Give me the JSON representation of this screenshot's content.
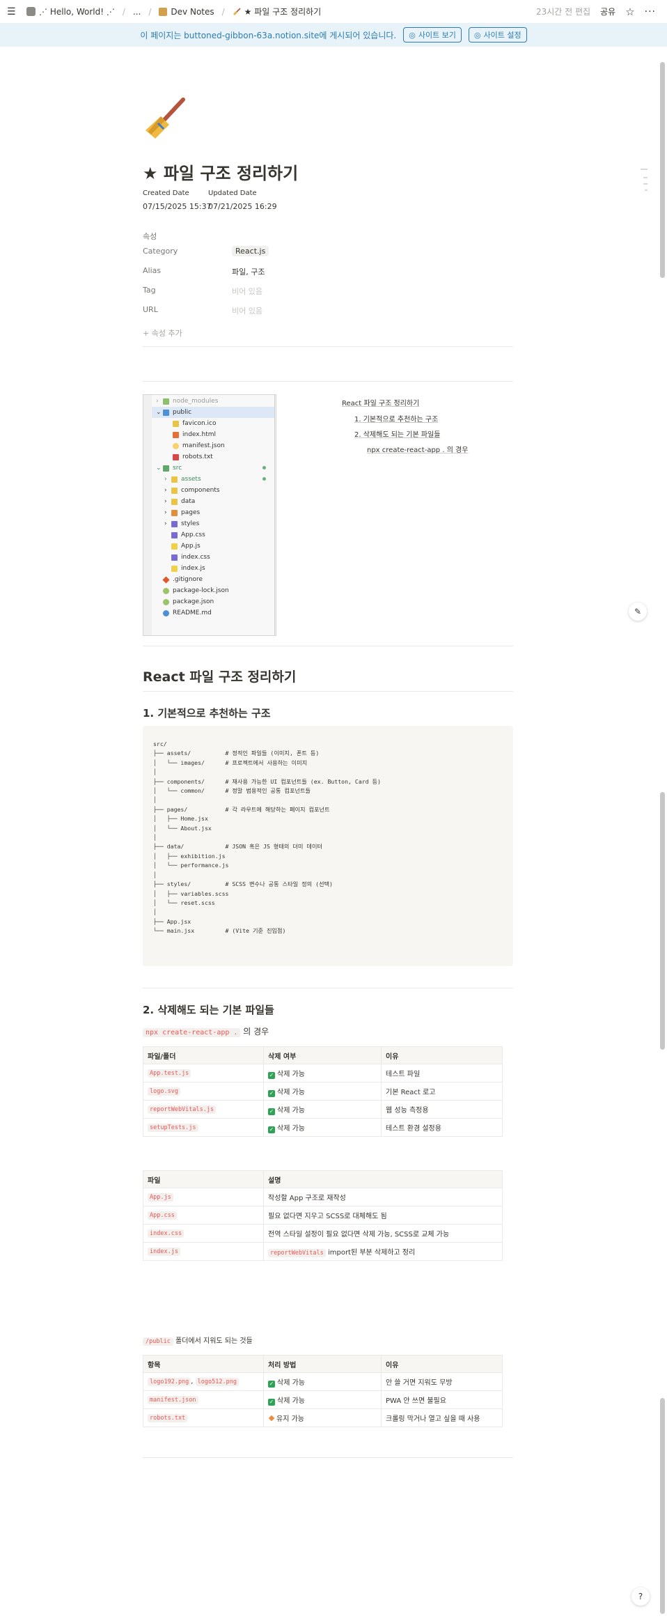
{
  "topbar": {
    "crumbs": [
      "⋰ Hello, World! ⋰",
      "...",
      "Dev Notes",
      "★ 파일 구조 정리하기"
    ],
    "edited": "23시간 전 편집",
    "share": "공유"
  },
  "banner": {
    "text": "이 페이지는 buttoned-gibbon-63a.notion.site에 게시되어 있습니다.",
    "view_site": "사이트 보기",
    "site_settings": "사이트 설정"
  },
  "page": {
    "title": "★ 파일 구조 정리하기",
    "created_label": "Created Date",
    "created_value": "07/15/2025 15:37",
    "updated_label": "Updated Date",
    "updated_value": "07/21/2025 16:29",
    "props_title": "속성",
    "props": [
      {
        "name": "Category",
        "value": "React.js"
      },
      {
        "name": "Alias",
        "value": "파일, 구조"
      },
      {
        "name": "Tag",
        "value": "비어 있음"
      },
      {
        "name": "URL",
        "value": "비어 있음"
      }
    ],
    "add_prop": "속성 추가"
  },
  "tree": {
    "items": [
      "node_modules",
      "public",
      "favicon.ico",
      "index.html",
      "manifest.json",
      "robots.txt",
      "src",
      "assets",
      "components",
      "data",
      "pages",
      "styles",
      "App.css",
      "App.js",
      "index.css",
      "index.js",
      ".gitignore",
      "package-lock.json",
      "package.json",
      "README.md"
    ]
  },
  "toc": {
    "items": [
      "React 파일 구조 정리하기",
      "1. 기본적으로 추천하는 구조",
      "2. 삭제해도 되는 기본 파일들",
      "npx create-react-app . 의 경우"
    ]
  },
  "section": {
    "h2": "React 파일 구조 정리하기",
    "h3_1": "1. 기본적으로 추천하는 구조",
    "code": "src/\n├── assets/          # 정적인 파일들 (이미지, 폰트 등)\n│   └── images/      # 프로젝트에서 사용하는 이미지\n│\n├── components/      # 재사용 가능한 UI 컴포넌트들 (ex. Button, Card 등)\n│   └── common/      # 정말 범용적인 공통 컴포넌트들\n│\n├── pages/           # 각 라우트에 해당하는 페이지 컴포넌트\n│   ├── Home.jsx\n│   └── About.jsx\n│\n├── data/            # JSON 혹은 JS 형태의 더미 데이터\n│   ├── exhibition.js\n│   └── performance.js\n│\n├── styles/          # SCSS 변수나 공통 스타일 정의 (선택)\n│   ├── variables.scss\n│   └── reset.scss\n│\n├── App.jsx\n└── main.jsx         # (Vite 기준 진입점)",
    "h3_2": "2. 삭제해도 되는 기본 파일들",
    "npx_code": "npx create-react-app .",
    "npx_suffix": "의 경우"
  },
  "table1": {
    "headers": [
      "파일/폴더",
      "삭제 여부",
      "이유"
    ],
    "rows": [
      [
        "App.test.js",
        "삭제 가능",
        "테스트 파일"
      ],
      [
        "logo.svg",
        "삭제 가능",
        "기본 React 로고"
      ],
      [
        "reportWebVitals.js",
        "삭제 가능",
        "웹 성능 측정용"
      ],
      [
        "setupTests.js",
        "삭제 가능",
        "테스트 환경 설정용"
      ]
    ]
  },
  "table2": {
    "headers": [
      "파일",
      "설명"
    ],
    "rows": [
      [
        "App.js",
        "작성할 App 구조로 재작성"
      ],
      [
        "App.css",
        "필요 없다면 지우고 SCSS로 대체해도 됨"
      ],
      [
        "index.css",
        "전역 스타일 설정이 필요 없다면 삭제 가능, SCSS로 교체 가능"
      ],
      [
        "index.js",
        "import된 부분 삭제하고 정리"
      ]
    ],
    "row4_code": "reportWebVitals"
  },
  "public_note": {
    "code": "/public",
    "text": "폴더에서 지워도 되는 것들"
  },
  "table3": {
    "headers": [
      "항목",
      "처리 방법",
      "이유"
    ],
    "rows": [
      [
        "logo192.png",
        "logo512.png",
        "삭제 가능",
        "안 쓸 거면 지워도 무방"
      ],
      [
        "manifest.json",
        "",
        "삭제 가능",
        "PWA 안 쓰면 불필요"
      ],
      [
        "robots.txt",
        "",
        "유지 가능",
        "크롤링 막거나 열고 싶을 때 사용"
      ]
    ]
  }
}
